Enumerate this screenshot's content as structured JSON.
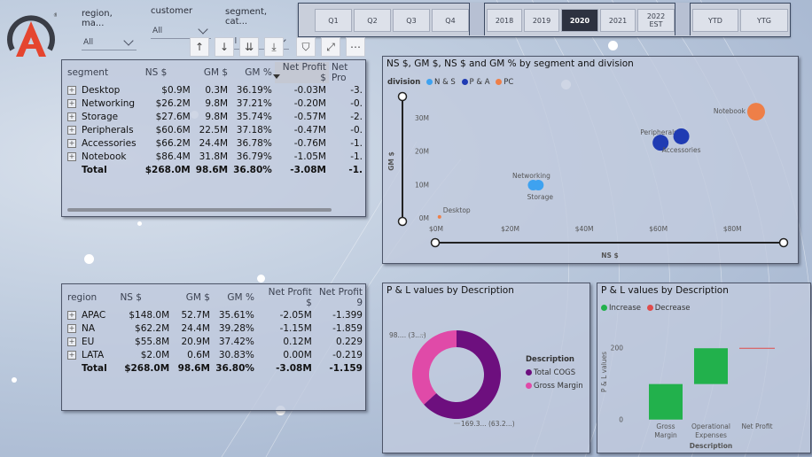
{
  "colors": {
    "ns": "#3ea2f0",
    "pa": "#1f3bb3",
    "pc": "#ee7f48",
    "total_cogs": "#6d0f7e",
    "gross_margin": "#e04aa8",
    "increase": "#22b14c",
    "decrease": "#e04b4b"
  },
  "slicers": [
    {
      "title": "region, ma...",
      "value": "All"
    },
    {
      "title": "customer",
      "value": "All"
    },
    {
      "title": "segment, cat...",
      "value": "All"
    }
  ],
  "quarters": [
    "Q1",
    "Q2",
    "Q3",
    "Q4"
  ],
  "years": [
    "2018",
    "2019",
    "2020",
    "2021",
    "2022 EST"
  ],
  "selected_year": "2020",
  "ytd_buttons": [
    "YTD",
    "YTG"
  ],
  "toolbar": {
    "icons": [
      "arrow-up-icon",
      "arrow-down-icon",
      "double-arrow-down-icon",
      "expand-hierarchy-icon",
      "filter-icon",
      "focus-mode-icon",
      "more-options-icon"
    ],
    "glyphs": [
      "↑",
      "↓",
      "⇊",
      "⤓",
      "⛉",
      "⤢",
      "⋯"
    ]
  },
  "segment_table": {
    "headers": [
      "segment",
      "NS $",
      "GM $",
      "GM %",
      "Net Profit $",
      "Net Pro"
    ],
    "rows": [
      {
        "label": "Desktop",
        "ns": "$0.9M",
        "gm": "0.3M",
        "gmp": "36.19%",
        "np": "-0.03M",
        "npp": "-3."
      },
      {
        "label": "Networking",
        "ns": "$26.2M",
        "gm": "9.8M",
        "gmp": "37.21%",
        "np": "-0.20M",
        "npp": "-0."
      },
      {
        "label": "Storage",
        "ns": "$27.6M",
        "gm": "9.8M",
        "gmp": "35.74%",
        "np": "-0.57M",
        "npp": "-2."
      },
      {
        "label": "Peripherals",
        "ns": "$60.6M",
        "gm": "22.5M",
        "gmp": "37.18%",
        "np": "-0.47M",
        "npp": "-0."
      },
      {
        "label": "Accessories",
        "ns": "$66.2M",
        "gm": "24.4M",
        "gmp": "36.78%",
        "np": "-0.76M",
        "npp": "-1."
      },
      {
        "label": "Notebook",
        "ns": "$86.4M",
        "gm": "31.8M",
        "gmp": "36.79%",
        "np": "-1.05M",
        "npp": "-1."
      }
    ],
    "total": {
      "label": "Total",
      "ns": "$268.0M",
      "gm": "98.6M",
      "gmp": "36.80%",
      "np": "-3.08M",
      "npp": "-1."
    }
  },
  "region_table": {
    "headers": [
      "region",
      "NS $",
      "GM $",
      "GM %",
      "Net Profit $",
      "Net Profit %"
    ],
    "header_shown": [
      "region",
      "NS $",
      "GM $",
      "GM %",
      "Net Profit $",
      "Net Profit 9"
    ],
    "rows": [
      {
        "label": "APAC",
        "ns": "$148.0M",
        "gm": "52.7M",
        "gmp": "35.61%",
        "np": "-2.05M",
        "npp": "-1.399"
      },
      {
        "label": "NA",
        "ns": "$62.2M",
        "gm": "24.4M",
        "gmp": "39.28%",
        "np": "-1.15M",
        "npp": "-1.859"
      },
      {
        "label": "EU",
        "ns": "$55.8M",
        "gm": "20.9M",
        "gmp": "37.42%",
        "np": "0.12M",
        "npp": "0.229"
      },
      {
        "label": "LATA",
        "ns": "$2.0M",
        "gm": "0.6M",
        "gmp": "30.83%",
        "np": "0.00M",
        "npp": "-0.219"
      }
    ],
    "total": {
      "label": "Total",
      "ns": "$268.0M",
      "gm": "98.6M",
      "gmp": "36.80%",
      "np": "-3.08M",
      "npp": "-1.159"
    }
  },
  "chart_data": [
    {
      "type": "scatter",
      "title": "NS $, GM $, NS $ and GM % by segment and division",
      "xlabel": "NS $",
      "ylabel": "GM $",
      "xlim": [
        0,
        90
      ],
      "ylim": [
        0,
        35
      ],
      "x_ticks": [
        "$0M",
        "$20M",
        "$40M",
        "$60M",
        "$80M"
      ],
      "x_tick_values": [
        0,
        20,
        40,
        60,
        80
      ],
      "y_ticks": [
        "0M",
        "10M",
        "20M",
        "30M"
      ],
      "y_tick_values": [
        0,
        10,
        20,
        30
      ],
      "legend_title": "division",
      "legend": [
        "N & S",
        "P & A",
        "PC"
      ],
      "points": [
        {
          "label": "Desktop",
          "division": "PC",
          "x": 0.9,
          "y": 0.3,
          "size": 2
        },
        {
          "label": "Networking",
          "division": "N & S",
          "x": 26.2,
          "y": 9.8,
          "size": 6
        },
        {
          "label": "Storage",
          "division": "N & S",
          "x": 27.6,
          "y": 9.8,
          "size": 6
        },
        {
          "label": "Peripherals",
          "division": "P & A",
          "x": 60.6,
          "y": 22.5,
          "size": 9
        },
        {
          "label": "Accessories",
          "division": "P & A",
          "x": 66.2,
          "y": 24.4,
          "size": 9
        },
        {
          "label": "Notebook",
          "division": "PC",
          "x": 86.4,
          "y": 31.8,
          "size": 10
        }
      ]
    },
    {
      "type": "pie",
      "title": "P & L values by Description",
      "legend_title": "Description",
      "slices": [
        {
          "label": "Total COGS",
          "value": 169.3,
          "display": "169.3... (63.2...)"
        },
        {
          "label": "Gross Margin",
          "value": 98.6,
          "display": "98.... (3....)"
        }
      ]
    },
    {
      "type": "bar",
      "subtype": "waterfall",
      "title": "P & L values by Description",
      "xlabel": "Description",
      "ylabel": "P & L values",
      "legend": [
        "Increase",
        "Decrease"
      ],
      "y_ticks": [
        "0",
        "200"
      ],
      "y_tick_values": [
        0,
        200
      ],
      "ylim": [
        -40,
        260
      ],
      "categories": [
        "Gross Margin",
        "Operational Expenses",
        "Net Profit"
      ],
      "category_labels": [
        [
          "Gross",
          "Margin"
        ],
        [
          "Operational",
          "Expenses"
        ],
        [
          "Net Profit"
        ]
      ],
      "steps": [
        {
          "category": "Gross Margin",
          "from": 0,
          "to": 98.6,
          "kind": "Increase"
        },
        {
          "category": "Operational Expenses",
          "from": 98.6,
          "to": 198,
          "kind": "Increase"
        },
        {
          "category": "Net Profit",
          "from": 198,
          "to": 198,
          "kind": "Decrease"
        }
      ]
    }
  ]
}
